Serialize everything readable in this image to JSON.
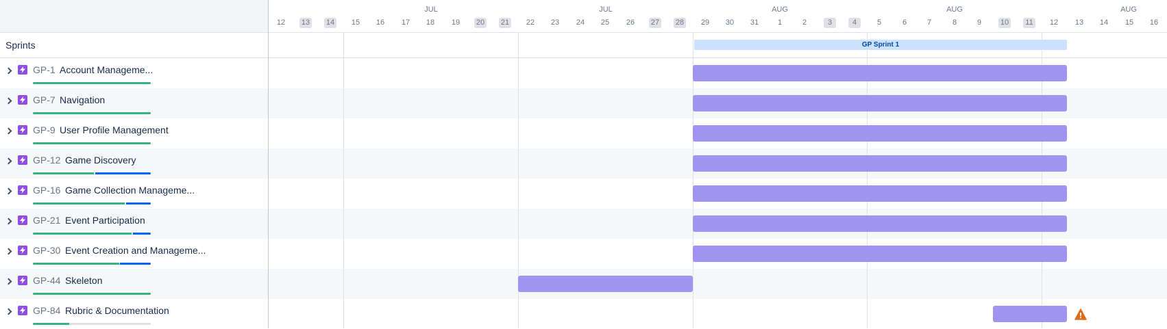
{
  "sprints_label": "Sprints",
  "colors": {
    "bar": "#a193f0",
    "sprint_bar": "#cce0ff",
    "done": "#36b37e",
    "in_progress": "#0065ff",
    "warning": "#de6c1a",
    "epic_icon": "#904ee2"
  },
  "months": [
    "JUL",
    "JUL",
    "AUG",
    "AUG",
    "AUG"
  ],
  "days": [
    "12",
    "13",
    "14",
    "15",
    "16",
    "17",
    "18",
    "19",
    "20",
    "21",
    "22",
    "23",
    "24",
    "25",
    "26",
    "27",
    "28",
    "29",
    "30",
    "31",
    "1",
    "2",
    "3",
    "4",
    "5",
    "6",
    "7",
    "8",
    "9",
    "10",
    "11",
    "12",
    "13",
    "14",
    "15",
    "16"
  ],
  "weekend_days": [
    "13",
    "14",
    "20",
    "21",
    "27",
    "28",
    "3",
    "4",
    "10",
    "11"
  ],
  "sprint": {
    "name": "GP Sprint 1"
  },
  "epics": [
    {
      "key": "GP-1",
      "title": "Account Manageme...",
      "done": 1.0,
      "in_progress": 0.0
    },
    {
      "key": "GP-7",
      "title": "Navigation",
      "done": 1.0,
      "in_progress": 0.0
    },
    {
      "key": "GP-9",
      "title": "User Profile Management",
      "done": 1.0,
      "in_progress": 0.0
    },
    {
      "key": "GP-12",
      "title": "Game Discovery",
      "done": 0.52,
      "in_progress": 0.48
    },
    {
      "key": "GP-16",
      "title": "Game Collection Manageme...",
      "done": 0.78,
      "in_progress": 0.22
    },
    {
      "key": "GP-21",
      "title": "Event Participation",
      "done": 0.84,
      "in_progress": 0.16
    },
    {
      "key": "GP-30",
      "title": "Event Creation and Manageme...",
      "done": 0.73,
      "in_progress": 0.27
    },
    {
      "key": "GP-44",
      "title": "Skeleton",
      "done": 1.0,
      "in_progress": 0.0
    },
    {
      "key": "GP-84",
      "title": "Rubric & Documentation",
      "done": 0.31,
      "in_progress": 0.0,
      "warning": true
    }
  ]
}
